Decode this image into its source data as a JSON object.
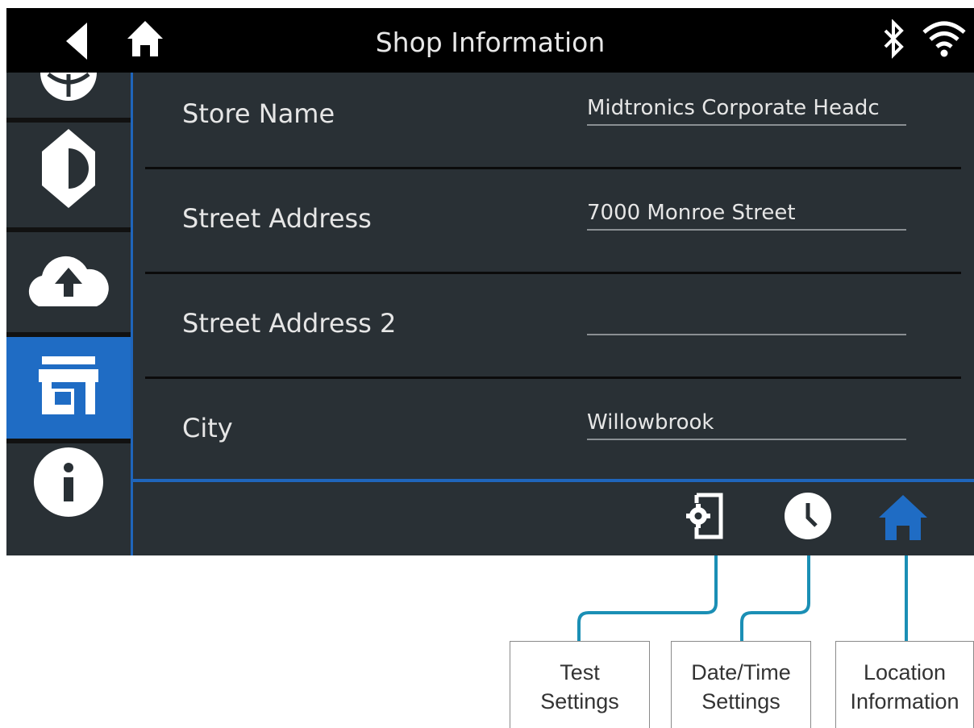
{
  "header": {
    "title": "Shop Information",
    "back_icon": "back-arrow-icon",
    "home_icon": "home-icon",
    "status_icons": [
      "bluetooth-icon",
      "wifi-icon"
    ]
  },
  "sidebar": {
    "items": [
      {
        "icon": "globe-icon",
        "active": false
      },
      {
        "icon": "brightness-icon",
        "active": false
      },
      {
        "icon": "cloud-upload-icon",
        "active": true,
        "note": ""
      },
      {
        "icon": "store-icon",
        "active": true
      },
      {
        "icon": "info-icon",
        "active": false
      }
    ]
  },
  "form": {
    "rows": [
      {
        "label": "Store Name",
        "value": "Midtronics Corporate Headc"
      },
      {
        "label": "Street Address",
        "value": "7000 Monroe Street"
      },
      {
        "label": "Street Address 2",
        "value": ""
      },
      {
        "label": "City",
        "value": "Willowbrook"
      }
    ]
  },
  "bottom_tabs": [
    {
      "icon": "device-settings-icon",
      "active": false
    },
    {
      "icon": "clock-icon",
      "active": false
    },
    {
      "icon": "home-icon",
      "active": true
    }
  ],
  "callouts": {
    "test_settings": {
      "line1": "Test",
      "line2": "Settings"
    },
    "date_time": {
      "line1": "Date/Time",
      "line2": "Settings"
    },
    "location": {
      "line1": "Location",
      "line2": "Information"
    }
  },
  "colors": {
    "background": "#293035",
    "topbar": "#000000",
    "accent": "#1f65bb",
    "active_sidebar": "#1f6cc4",
    "callout_line": "#1b8fb5",
    "text": "#e6e6e6"
  }
}
